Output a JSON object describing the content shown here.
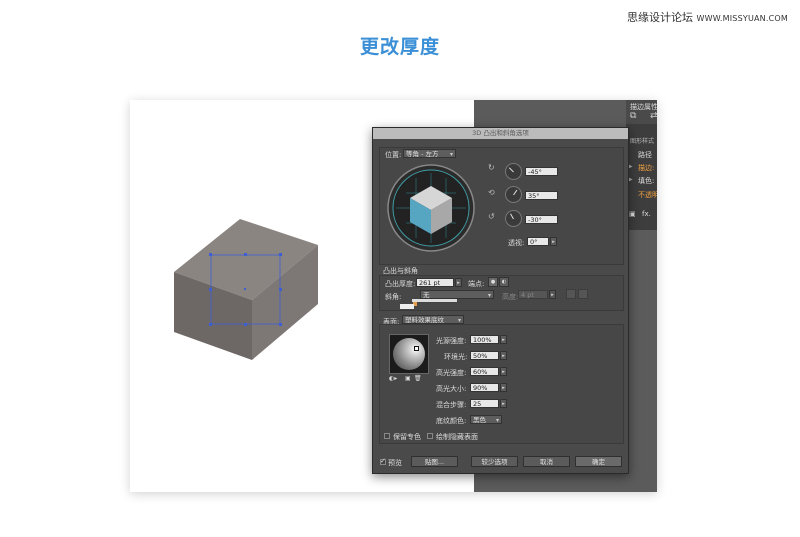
{
  "watermark": {
    "text": "思缘设计论坛",
    "site": "WWW.MISSYUAN.COM"
  },
  "page_title": "更改厚度",
  "panel": {
    "tab_label": "描边属性",
    "sub_label": "图形样式",
    "rows": [
      {
        "label": "路径"
      },
      {
        "label": "描边:"
      },
      {
        "label": "填色:"
      },
      {
        "label": "不透明"
      }
    ],
    "fx_label": "fx."
  },
  "dialog": {
    "title": "3D 凸出和斜角选项",
    "position": {
      "label": "位置:",
      "value": "等角 - 左方"
    },
    "rotation": {
      "x": "-45°",
      "y": "35°",
      "z": "-30°",
      "perspective_label": "透视:",
      "perspective": "0°"
    },
    "extrude": {
      "section_label": "凸出与斜角",
      "depth_label": "凸出厚度:",
      "depth_value": "261 pt",
      "cap_label": "端点:",
      "bevel_label": "斜角:",
      "bevel_value": "无",
      "height_label": "高度:",
      "height_value": "4 pt"
    },
    "surface": {
      "label": "表面:",
      "value": "塑料效果底纹",
      "light_intensity_label": "光源强度:",
      "light_intensity": "100%",
      "ambient_label": "环境光:",
      "ambient": "50%",
      "highlight_intensity_label": "高光强度:",
      "highlight_intensity": "60%",
      "highlight_size_label": "高光大小:",
      "highlight_size": "90%",
      "blend_steps_label": "混合步骤:",
      "blend_steps": "25",
      "shading_color_label": "底纹颜色:",
      "shading_color": "黑色",
      "preserve_spot_label": "保留专色",
      "draw_hidden_label": "绘制隐藏表面"
    },
    "buttons": {
      "preview_label": "预览",
      "map_label": "贴图...",
      "fewer_options_label": "较少选项",
      "cancel_label": "取消",
      "ok_label": "确定"
    }
  }
}
